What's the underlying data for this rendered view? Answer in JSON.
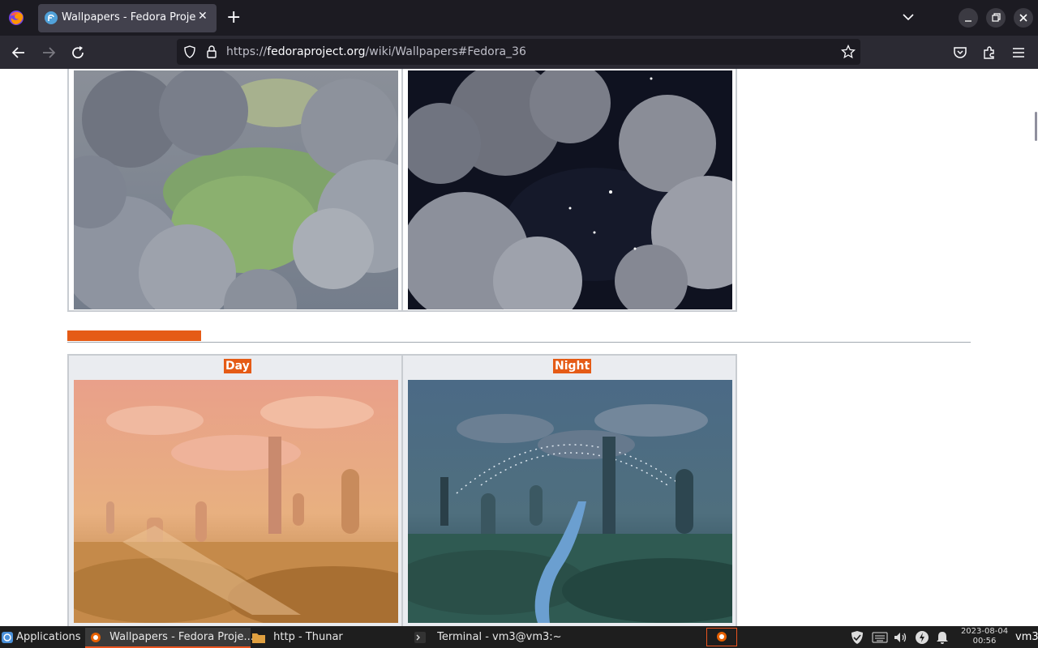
{
  "browser": {
    "tab_title": "Wallpapers - Fedora Project",
    "tab_close": "✕",
    "new_tab": "+",
    "url_prefix": "https://",
    "url_domain": "fedoraproject.org",
    "url_path": "/wiki/Wallpapers#Fedora_36"
  },
  "icons": [
    "firefox-icon",
    "fedora-favicon",
    "back-arrow-icon",
    "forward-arrow-icon",
    "reload-icon",
    "shield-icon",
    "lock-icon",
    "bookmark-star-icon",
    "pocket-icon",
    "extensions-icon",
    "hamburger-menu-icon"
  ],
  "page": {
    "gallery2": {
      "day_caption": "Day",
      "night_caption": "Night"
    }
  },
  "taskbar": {
    "applications": "Applications",
    "tasks": [
      {
        "label": "Wallpapers - Fedora Proje..."
      },
      {
        "label": "http - Thunar"
      },
      {
        "label": "Terminal - vm3@vm3:~"
      }
    ],
    "clock_date": "2023-08-04",
    "clock_time": "00:56",
    "user": "vm3"
  },
  "colors": {
    "accent": "#e55b16",
    "tab_bar": "#1c1b22",
    "nav_bar": "#2b2a33"
  }
}
